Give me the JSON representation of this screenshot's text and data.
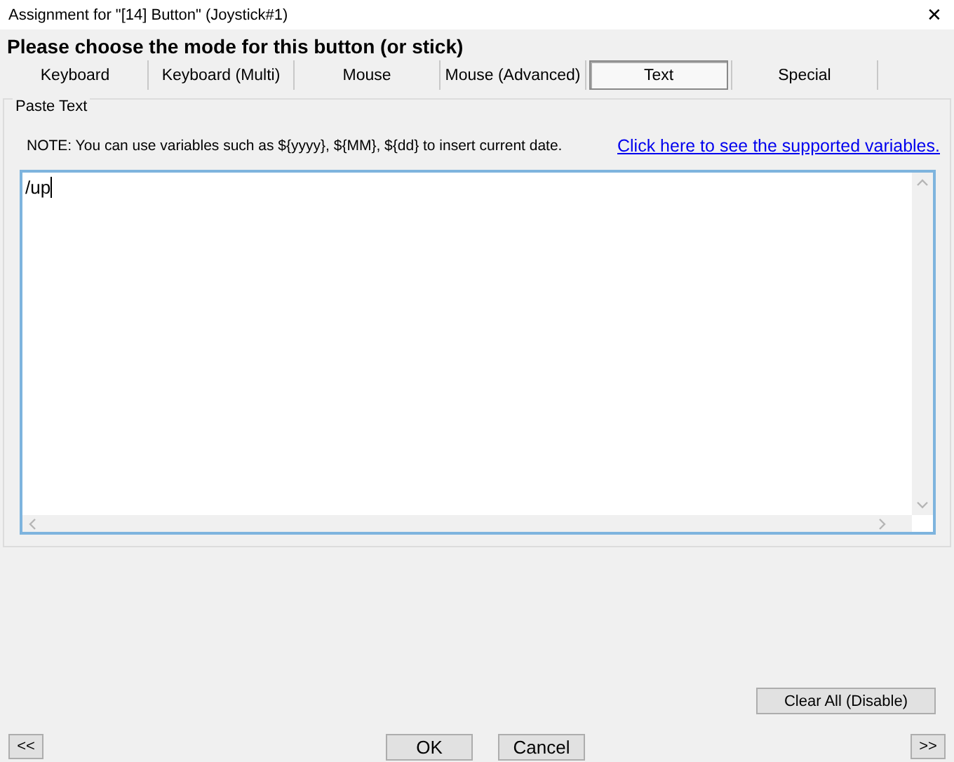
{
  "window": {
    "title": "Assignment for \"[14] Button\" (Joystick#1)",
    "close": "✕"
  },
  "heading": "Please choose the mode for this button (or stick)",
  "tabs": [
    {
      "label": "Keyboard",
      "selected": false
    },
    {
      "label": "Keyboard (Multi)",
      "selected": false
    },
    {
      "label": "Mouse",
      "selected": false
    },
    {
      "label": "Mouse (Advanced)",
      "selected": false
    },
    {
      "label": "Text",
      "selected": true
    },
    {
      "label": "Special",
      "selected": false
    }
  ],
  "group": {
    "title": "Paste Text",
    "note": "NOTE: You can use variables such as ${yyyy}, ${MM}, ${dd} to insert current date.",
    "link": "Click here to see the supported variables.",
    "text": "/up"
  },
  "buttons": {
    "clear": "Clear All (Disable)",
    "prev": "<<",
    "ok": "OK",
    "cancel": "Cancel",
    "next": ">>"
  }
}
